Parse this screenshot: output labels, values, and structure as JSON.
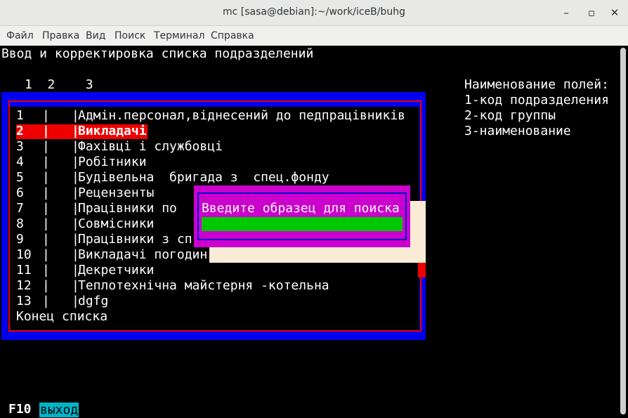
{
  "window": {
    "title": "mc [sasa@debian]:~/work/iceB/buhg",
    "minimize_glyph": "–",
    "maximize_glyph": "▫",
    "close_glyph": "✕"
  },
  "menu": [
    "Файл",
    "Правка",
    "Вид",
    "Поиск",
    "Терминал",
    "Справка"
  ],
  "screen": {
    "heading": "Ввод и корректировка списка подразделений",
    "column_numbers": "1  2    3",
    "legend": {
      "title": "Наименование полей:",
      "items": [
        "1-код подразделения",
        "2-код группы",
        "3-наименование"
      ]
    },
    "rows": [
      {
        "code": "1",
        "name": "Адмін.персонал,віднесений до педпрацівників"
      },
      {
        "code": "2",
        "name": "Викладачі"
      },
      {
        "code": "3",
        "name": "Фахівці і службовці"
      },
      {
        "code": "4",
        "name": "Робітники"
      },
      {
        "code": "5",
        "name": "Будівельна  бригада з  спец.фонду"
      },
      {
        "code": "6",
        "name": "Рецензенты"
      },
      {
        "code": "7",
        "name": "Працівники по"
      },
      {
        "code": "8",
        "name": "Совмісники"
      },
      {
        "code": "9",
        "name": "Працівники з сп"
      },
      {
        "code": "10",
        "name": "Викладачі погодин"
      },
      {
        "code": "11",
        "name": "Декретчики"
      },
      {
        "code": "12",
        "name": "Теплотехнічна майстерня -котельна"
      },
      {
        "code": "13",
        "name": "dgfg"
      }
    ],
    "separator": "|",
    "selected_row": 2,
    "end_of_list": "Конец списка"
  },
  "search_dialog": {
    "prompt": "Введите образец для поиска",
    "value": ""
  },
  "footer": {
    "key": "F10",
    "label": "выход"
  },
  "colors": {
    "frame_blue": "#0000ee",
    "highlight_red": "#ee0000",
    "dialog_magenta": "#cc00cc",
    "input_green": "#00c800",
    "hint_cyan": "#00b4c8"
  }
}
